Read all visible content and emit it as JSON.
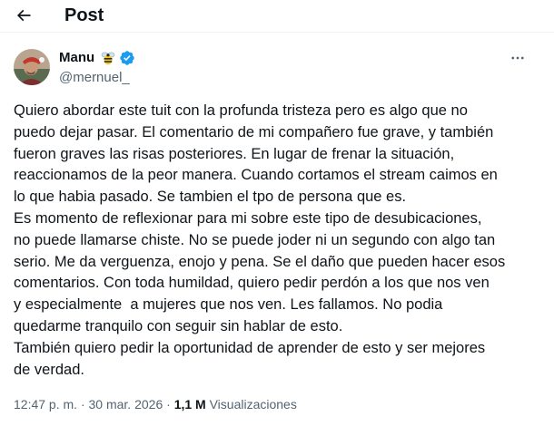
{
  "header": {
    "title": "Post"
  },
  "author": {
    "name": "Manu",
    "handle": "@mernuel_"
  },
  "tweet": {
    "text": "Quiero abordar este tuit con la profunda tristeza pero es algo que no\npuedo dejar pasar. El comentario de mi compañero fue grave, y también\nfueron graves las risas posteriores. En lugar de frenar la situación,\nreaccionamos de la peor manera. Cuando cortamos el stream caimos en\nlo que habia pasado. Se tambien el tpo de persona que es.\nEs momento de reflexionar para mi sobre este tipo de desubicaciones,\nno puede llamarse chiste. No se puede joder ni un segundo con algo tan\nserio. Me da verguenza, enojo y pena. Se el daño que pueden hacer esos\ncomentarios. Con toda humildad, quiero pedir perdón a los que nos ven\ny especialmente  a mujeres que nos ven. Les fallamos. No podia\nquedarme tranquilo con seguir sin hablar de esto.\nTambién quiero pedir la oportunidad de aprender de esto y ser mejores\nde verdad."
  },
  "meta": {
    "time": "12:47 p. m.",
    "separator": "·",
    "date": "30 mar. 2026",
    "views_count": "1,1 M",
    "views_label": "Visualizaciones"
  },
  "icons": {
    "back": "arrow-left-icon",
    "verified": "verified-badge-icon",
    "bee": "bee-emoji-icon",
    "more": "more-horizontal-icon"
  },
  "colors": {
    "text_primary": "#0f1419",
    "text_secondary": "#536471",
    "verified_blue": "#1d9bf0",
    "separator": "#eff3f4"
  }
}
